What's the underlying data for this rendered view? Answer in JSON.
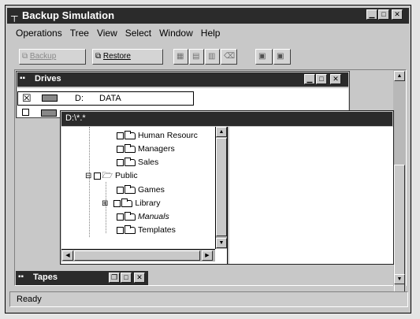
{
  "app": {
    "title": "Backup Simulation"
  },
  "menu": [
    "Operations",
    "Tree",
    "View",
    "Select",
    "Window",
    "Help"
  ],
  "toolbar": {
    "backup_label": "Backup",
    "restore_label": "Restore"
  },
  "drives_window": {
    "title": "Drives",
    "rows": [
      {
        "checked": "☒",
        "letter": "D:",
        "name": "DATA"
      },
      {
        "checked": "",
        "letter": "",
        "name": ""
      }
    ]
  },
  "dir_window": {
    "title": "D:\\*.*",
    "tree": [
      {
        "label": "Human Resourc",
        "expander": ""
      },
      {
        "label": "Managers",
        "expander": ""
      },
      {
        "label": "Sales",
        "expander": ""
      },
      {
        "label": "Public",
        "expander": "⊟"
      },
      {
        "label": "Games",
        "expander": ""
      },
      {
        "label": "Library",
        "expander": "⊞"
      },
      {
        "label": "Manuals",
        "expander": ""
      },
      {
        "label": "Templates",
        "expander": ""
      }
    ]
  },
  "tapes_window": {
    "title": "Tapes"
  },
  "status": {
    "text": "Ready"
  }
}
